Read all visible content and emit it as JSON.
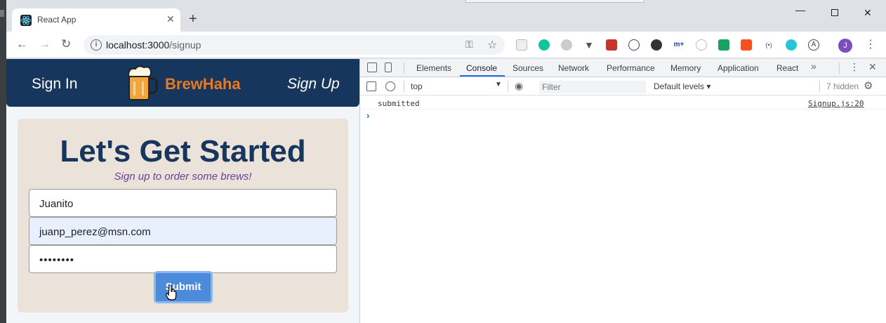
{
  "browser": {
    "tab_title": "React App",
    "tab_close": "✕",
    "new_tab": "+",
    "url_host": "localhost:3000",
    "url_path": "/signup",
    "profile_initial": "J"
  },
  "page": {
    "nav": {
      "sign_in": "Sign In",
      "brand": "BrewHaha",
      "sign_up": "Sign Up"
    },
    "form": {
      "heading": "Let's Get Started",
      "subheading": "Sign up to order some brews!",
      "name_value": "Juanito",
      "email_value": "juanp_perez@msn.com",
      "password_value": "••••••••",
      "submit_label": "Submit"
    }
  },
  "devtools": {
    "tabs": [
      "Elements",
      "Console",
      "Sources",
      "Network",
      "Performance",
      "Memory",
      "Application",
      "React"
    ],
    "active_tab": "Console",
    "more_tabs": "»",
    "context": "top",
    "filter_placeholder": "Filter",
    "levels": "Default levels ▾",
    "hidden": "7 hidden",
    "log": {
      "message": "submitted",
      "source": "Signup.js:20"
    },
    "prompt": "›"
  },
  "colors": {
    "navbar": "#16365e",
    "brand": "#e37b26",
    "card": "#ebe2d9",
    "subheading": "#6b3f98",
    "submit": "#4b8bd9"
  }
}
